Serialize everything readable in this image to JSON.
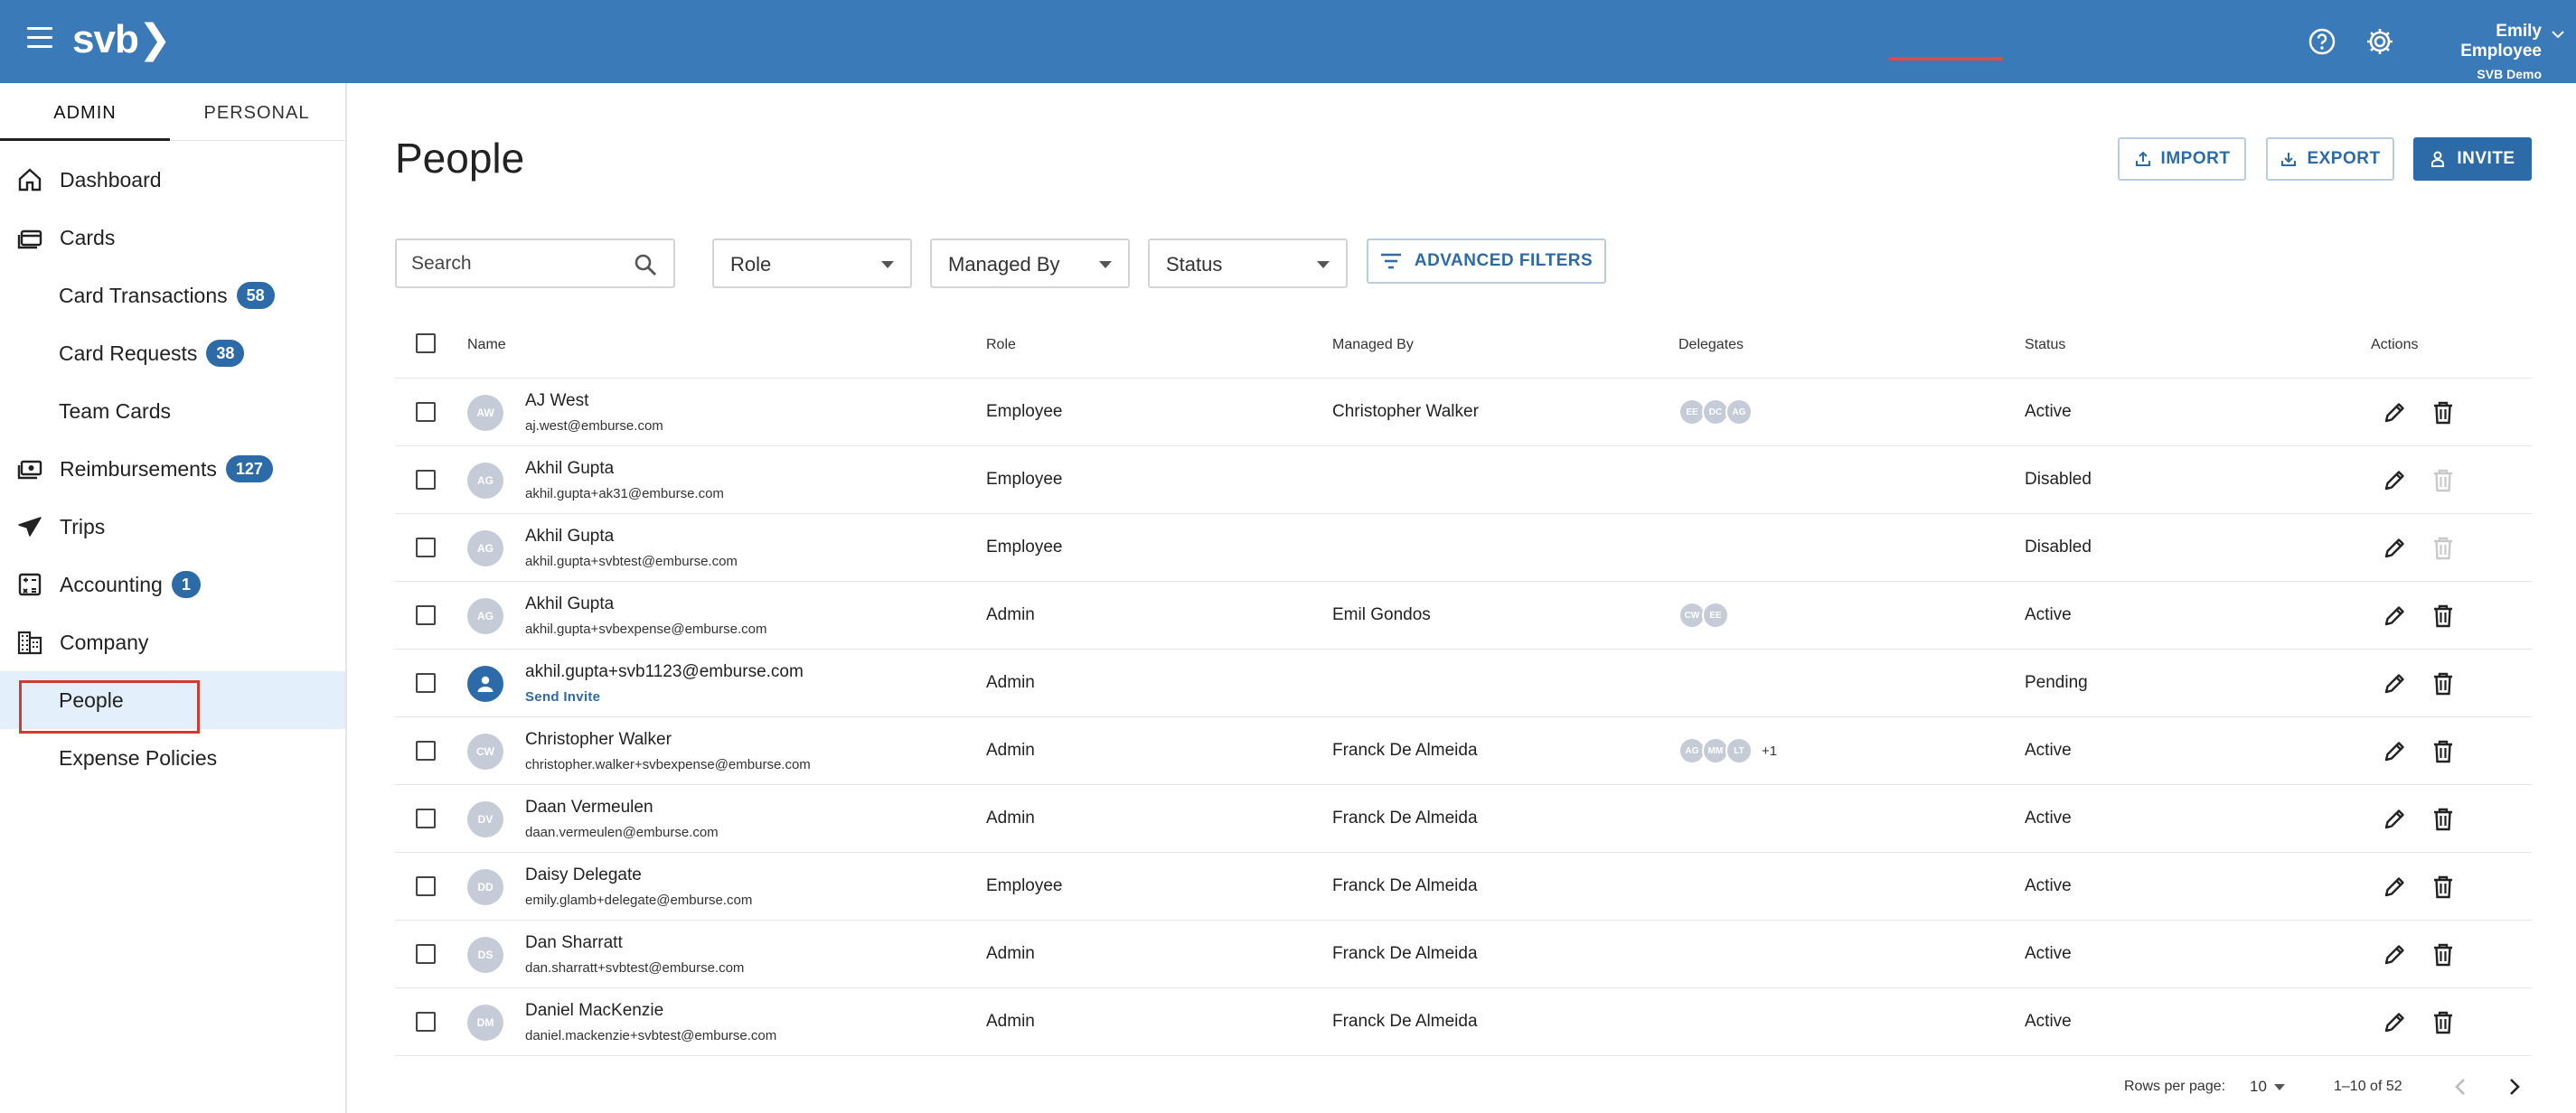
{
  "header": {
    "logo": "svb❯",
    "user_name": "Emily Employee",
    "company": "SVB Demo Company"
  },
  "sidebar": {
    "tabs": [
      "ADMIN",
      "PERSONAL"
    ],
    "items": [
      {
        "label": "Dashboard",
        "icon": "home-icon"
      },
      {
        "label": "Cards",
        "icon": "cards-icon"
      },
      {
        "label": "Card Transactions",
        "badge": "58"
      },
      {
        "label": "Card Requests",
        "badge": "38"
      },
      {
        "label": "Team Cards"
      },
      {
        "label": "Reimbursements",
        "badge": "127",
        "icon": "money-icon"
      },
      {
        "label": "Trips",
        "icon": "plane-icon"
      },
      {
        "label": "Accounting",
        "badge": "1",
        "icon": "accounting-icon"
      },
      {
        "label": "Company",
        "icon": "building-icon"
      },
      {
        "label": "People"
      },
      {
        "label": "Expense Policies"
      }
    ]
  },
  "main": {
    "title": "People",
    "import_label": "IMPORT",
    "export_label": "EXPORT",
    "invite_label": "INVITE",
    "search_placeholder": "Search",
    "filters": {
      "role": "Role",
      "managed_by": "Managed By",
      "status": "Status",
      "advanced": "ADVANCED FILTERS"
    }
  },
  "table": {
    "columns": {
      "name": "Name",
      "role": "Role",
      "managed_by": "Managed By",
      "delegates": "Delegates",
      "status": "Status",
      "actions": "Actions"
    },
    "rows": [
      {
        "initials": "AW",
        "name": "AJ West",
        "email": "aj.west@emburse.com",
        "role": "Employee",
        "managed_by": "Christopher Walker",
        "delegates": [
          "EE",
          "DC",
          "AG"
        ],
        "more": "",
        "status": "Active"
      },
      {
        "initials": "AG",
        "name": "Akhil Gupta",
        "email": "akhil.gupta+ak31@emburse.com",
        "role": "Employee",
        "managed_by": "",
        "delegates": [],
        "more": "",
        "status": "Disabled"
      },
      {
        "initials": "AG",
        "name": "Akhil Gupta",
        "email": "akhil.gupta+svbtest@emburse.com",
        "role": "Employee",
        "managed_by": "",
        "delegates": [],
        "more": "",
        "status": "Disabled"
      },
      {
        "initials": "AG",
        "name": "Akhil Gupta",
        "email": "akhil.gupta+svbexpense@emburse.com",
        "role": "Admin",
        "managed_by": "Emil Gondos",
        "delegates": [
          "CW",
          "EE"
        ],
        "more": "",
        "status": "Active"
      },
      {
        "initials": "",
        "name": "akhil.gupta+svb1123@emburse.com",
        "email": "Send Invite",
        "role": "Admin",
        "managed_by": "",
        "delegates": [],
        "more": "",
        "status": "Pending",
        "pending": true
      },
      {
        "initials": "CW",
        "name": "Christopher Walker",
        "email": "christopher.walker+svbexpense@emburse.com",
        "role": "Admin",
        "managed_by": "Franck De Almeida",
        "delegates": [
          "AG",
          "MM",
          "LT"
        ],
        "more": "+1",
        "status": "Active"
      },
      {
        "initials": "DV",
        "name": "Daan Vermeulen",
        "email": "daan.vermeulen@emburse.com",
        "role": "Admin",
        "managed_by": "Franck De Almeida",
        "delegates": [],
        "more": "",
        "status": "Active"
      },
      {
        "initials": "DD",
        "name": "Daisy Delegate",
        "email": "emily.glamb+delegate@emburse.com",
        "role": "Employee",
        "managed_by": "Franck De Almeida",
        "delegates": [],
        "more": "",
        "status": "Active"
      },
      {
        "initials": "DS",
        "name": "Dan Sharratt",
        "email": "dan.sharratt+svbtest@emburse.com",
        "role": "Admin",
        "managed_by": "Franck De Almeida",
        "delegates": [],
        "more": "",
        "status": "Active"
      },
      {
        "initials": "DM",
        "name": "Daniel MacKenzie",
        "email": "daniel.mackenzie+svbtest@emburse.com",
        "role": "Admin",
        "managed_by": "Franck De Almeida",
        "delegates": [],
        "more": "",
        "status": "Active"
      }
    ]
  },
  "pagination": {
    "rows_per_page_label": "Rows per page:",
    "rows_per_page": "10",
    "range": "1–10 of 52"
  },
  "colors": {
    "header": "#3a7ab8",
    "accent": "#2d6aa8",
    "highlight": "#d43b30"
  }
}
